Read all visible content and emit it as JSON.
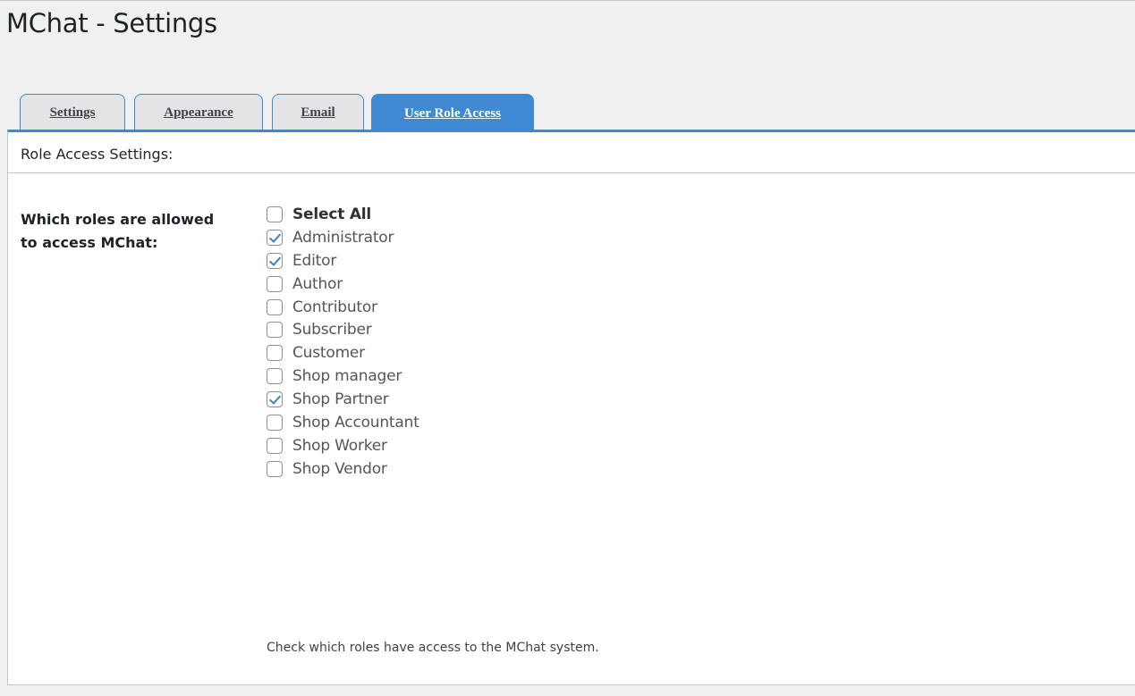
{
  "page": {
    "title": "MChat - Settings"
  },
  "tabs": [
    {
      "label": "Settings",
      "active": false
    },
    {
      "label": "Appearance",
      "active": false
    },
    {
      "label": "Email",
      "active": false
    },
    {
      "label": "User Role Access",
      "active": true
    }
  ],
  "panel": {
    "heading": "Role Access Settings:",
    "field_label": "Which roles are allowed to access MChat:",
    "help_text": "Check which roles have access to the MChat system."
  },
  "roles": [
    {
      "label": "Select All",
      "checked": false
    },
    {
      "label": "Administrator",
      "checked": true
    },
    {
      "label": "Editor",
      "checked": true
    },
    {
      "label": "Author",
      "checked": false
    },
    {
      "label": "Contributor",
      "checked": false
    },
    {
      "label": "Subscriber",
      "checked": false
    },
    {
      "label": "Customer",
      "checked": false
    },
    {
      "label": "Shop manager",
      "checked": false
    },
    {
      "label": "Shop Partner",
      "checked": true
    },
    {
      "label": "Shop Accountant",
      "checked": false
    },
    {
      "label": "Shop Worker",
      "checked": false
    },
    {
      "label": "Shop Vendor",
      "checked": false
    }
  ],
  "colors": {
    "accent": "#3f8ad3",
    "check": "#3582c4",
    "background": "#f0f0f1"
  }
}
